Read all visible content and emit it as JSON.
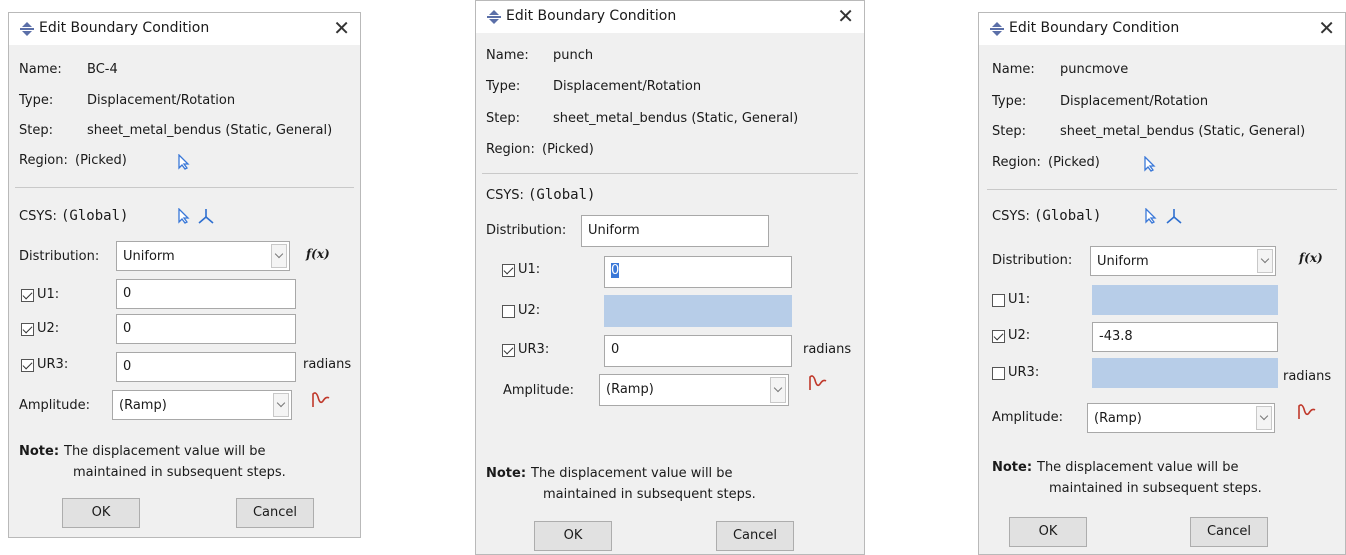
{
  "dialogs": [
    {
      "title": "Edit Boundary Condition",
      "name_label": "Name:",
      "name": "BC-4",
      "type_label": "Type:",
      "type": "Displacement/Rotation",
      "step_label": "Step:",
      "step": "sheet_metal_bendus (Static, General)",
      "region_label": "Region:",
      "region": "(Picked)",
      "csys_label": "CSYS:",
      "csys": "(Global)",
      "distribution_label": "Distribution:",
      "distribution": "Uniform",
      "fx": "f(x)",
      "u1_label": "U1:",
      "u1_checked": true,
      "u1": "0",
      "u2_label": "U2:",
      "u2_checked": true,
      "u2": "0",
      "ur3_label": "UR3:",
      "ur3_checked": true,
      "ur3": "0",
      "radians": "radians",
      "amplitude_label": "Amplitude:",
      "amplitude": "(Ramp)",
      "note_label": "Note:",
      "note_line1": "The displacement value will be",
      "note_line2": "maintained in subsequent steps.",
      "ok": "OK",
      "cancel": "Cancel"
    },
    {
      "title": "Edit Boundary Condition",
      "name_label": "Name:",
      "name": "punch",
      "type_label": "Type:",
      "type": "Displacement/Rotation",
      "step_label": "Step:",
      "step": "sheet_metal_bendus (Static, General)",
      "region_label": "Region:",
      "region": "(Picked)",
      "csys_label": "CSYS:",
      "csys": "(Global)",
      "distribution_label": "Distribution:",
      "distribution": "Uniform",
      "u1_label": "U1:",
      "u1_checked": true,
      "u1": "0",
      "u2_label": "U2:",
      "u2_checked": false,
      "u2": "",
      "ur3_label": "UR3:",
      "ur3_checked": true,
      "ur3": "0",
      "radians": "radians",
      "amplitude_label": "Amplitude:",
      "amplitude": "(Ramp)",
      "note_label": "Note:",
      "note_line1": "The displacement value will be",
      "note_line2": "maintained in subsequent steps.",
      "ok": "OK",
      "cancel": "Cancel"
    },
    {
      "title": "Edit Boundary Condition",
      "name_label": "Name:",
      "name": "puncmove",
      "type_label": "Type:",
      "type": "Displacement/Rotation",
      "step_label": "Step:",
      "step": "sheet_metal_bendus (Static, General)",
      "region_label": "Region:",
      "region": "(Picked)",
      "csys_label": "CSYS:",
      "csys": "(Global)",
      "distribution_label": "Distribution:",
      "distribution": "Uniform",
      "fx": "f(x)",
      "u1_label": "U1:",
      "u1_checked": false,
      "u1": "",
      "u2_label": "U2:",
      "u2_checked": true,
      "u2": "-43.8",
      "ur3_label": "UR3:",
      "ur3_checked": false,
      "ur3": "",
      "radians": "radians",
      "amplitude_label": "Amplitude:",
      "amplitude": "(Ramp)",
      "note_label": "Note:",
      "note_line1": "The displacement value will be",
      "note_line2": "maintained in subsequent steps.",
      "ok": "OK",
      "cancel": "Cancel"
    }
  ],
  "colors": {
    "select_arrow": "#3a78d8",
    "csys_icon": "#2e6fd0",
    "amplitude_icon": "#c0392b",
    "disabled_field": "#b7cde8"
  }
}
